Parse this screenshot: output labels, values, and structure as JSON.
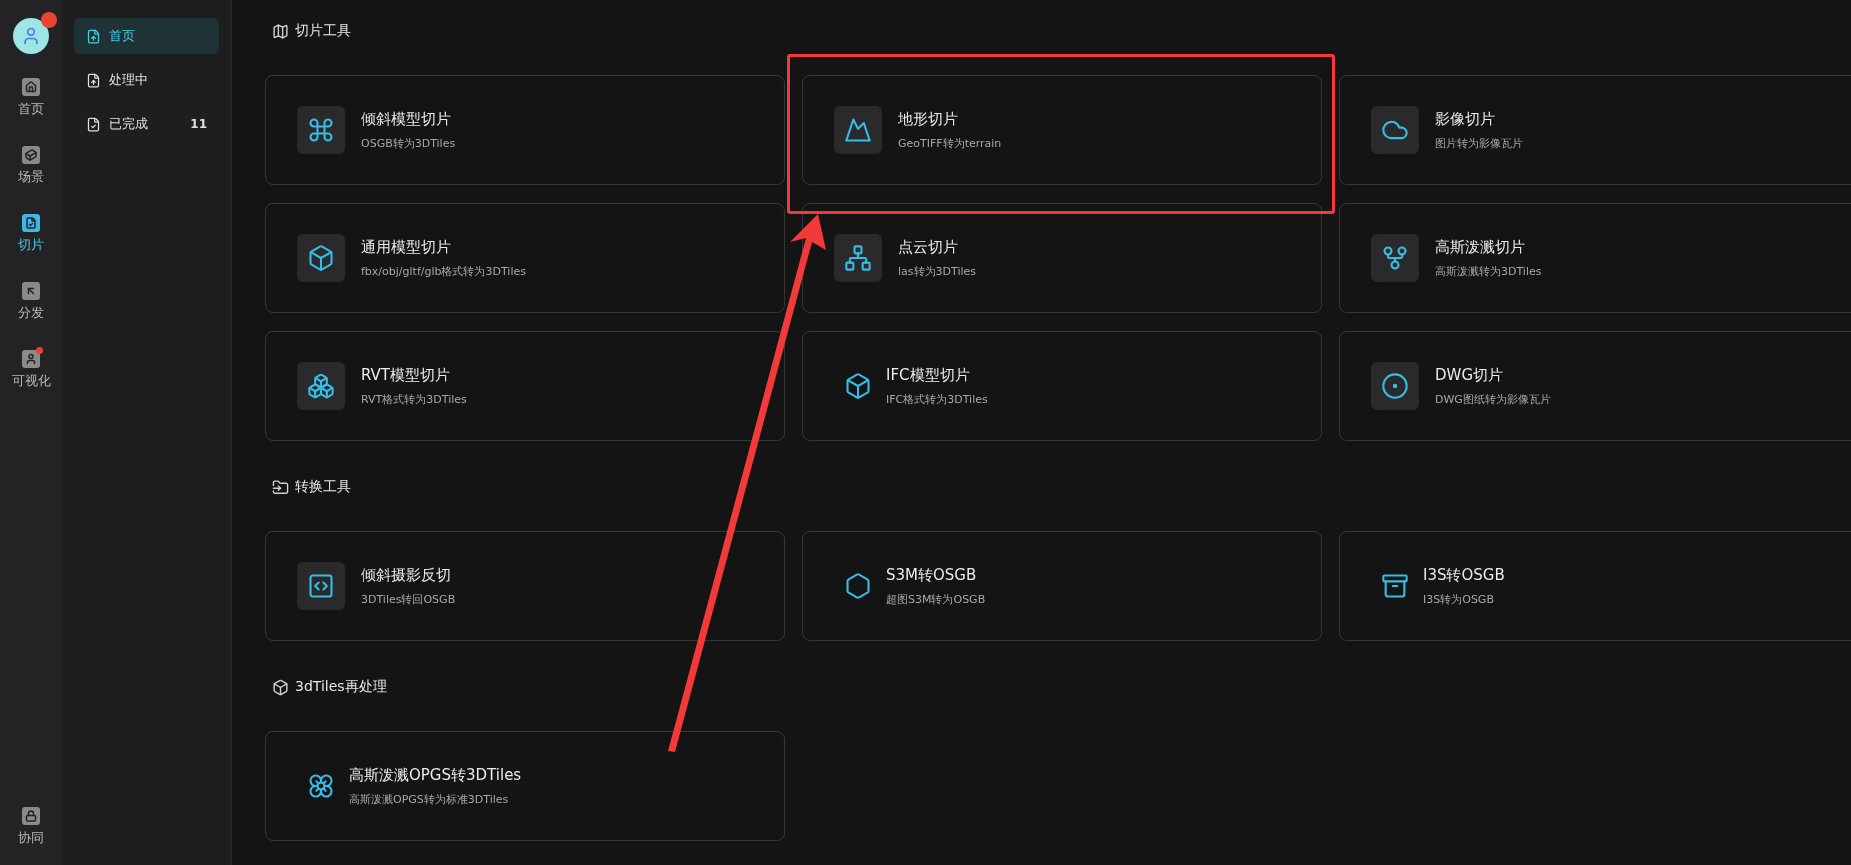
{
  "rail": {
    "items": [
      {
        "label": "首页",
        "selected": false,
        "dot": false
      },
      {
        "label": "场景",
        "selected": false,
        "dot": false
      },
      {
        "label": "切片",
        "selected": true,
        "dot": false
      },
      {
        "label": "分发",
        "selected": false,
        "dot": false
      },
      {
        "label": "可视化",
        "selected": false,
        "dot": true
      }
    ],
    "bottom_item": {
      "label": "协同"
    }
  },
  "sidebar": {
    "items": [
      {
        "label": "首页",
        "selected": true
      },
      {
        "label": "处理中",
        "selected": false
      },
      {
        "label": "已完成",
        "selected": false,
        "count": "11"
      }
    ]
  },
  "sections": [
    {
      "title": "切片工具",
      "cards": [
        {
          "title": "倾斜模型切片",
          "subtitle": "OSGB转为3DTiles",
          "boxed": true
        },
        {
          "title": "地形切片",
          "subtitle": "GeoTIFF转为terrain",
          "boxed": true
        },
        {
          "title": "影像切片",
          "subtitle": "图片转为影像瓦片",
          "boxed": true
        },
        {
          "title": "通用模型切片",
          "subtitle": "fbx/obj/gltf/glb格式转为3DTiles",
          "boxed": true
        },
        {
          "title": "点云切片",
          "subtitle": "las转为3DTiles",
          "boxed": true
        },
        {
          "title": "高斯泼溅切片",
          "subtitle": "高斯泼溅转为3DTiles",
          "boxed": true
        },
        {
          "title": "RVT模型切片",
          "subtitle": "RVT格式转为3DTiles",
          "boxed": true
        },
        {
          "title": "IFC模型切片",
          "subtitle": "IFC格式转为3DTiles",
          "boxed": false
        },
        {
          "title": "DWG切片",
          "subtitle": "DWG图纸转为影像瓦片",
          "boxed": true
        }
      ]
    },
    {
      "title": "转换工具",
      "cards": [
        {
          "title": "倾斜摄影反切",
          "subtitle": "3DTiles转回OSGB",
          "boxed": true
        },
        {
          "title": "S3M转OSGB",
          "subtitle": "超图S3M转为OSGB",
          "boxed": false
        },
        {
          "title": "I3S转OSGB",
          "subtitle": "I3S转为OSGB",
          "boxed": false
        }
      ]
    },
    {
      "title": "3dTiles再处理",
      "cards": [
        {
          "title": "高斯泼溅OPGS转3DTiles",
          "subtitle": "高斯泼溅OPGS转为标准3DTiles",
          "boxed": false
        }
      ]
    }
  ]
}
